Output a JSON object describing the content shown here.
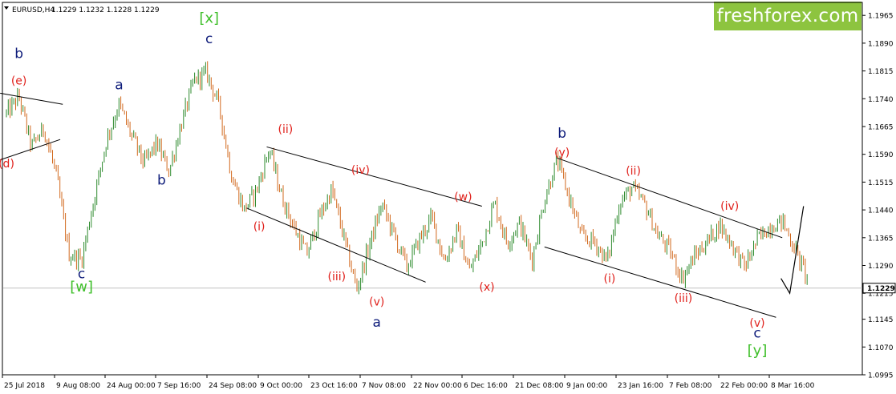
{
  "brand": {
    "logo_text": "freshforex.com"
  },
  "colors": {
    "up": "#2e8b2e",
    "down": "#d2691e",
    "red_label": "#e0201b",
    "blue_label": "#0d1b7a",
    "green_label": "#3fbf2a",
    "brand": "#8dc43f"
  },
  "chart_data": {
    "type": "candlestick",
    "symbol_label": "EURUSD,H4",
    "ohlc_label": "1.1229 1.1232 1.1228 1.1229",
    "current_price": 1.1229,
    "current_price_label": "1.1229",
    "ylim": [
      1.0995,
      1.2
    ],
    "y_ticks": [
      "1.1965",
      "1.1890",
      "1.1815",
      "1.1740",
      "1.1665",
      "1.1590",
      "1.1515",
      "1.1440",
      "1.1365",
      "1.1290",
      "1.1215",
      "1.1145",
      "1.1070",
      "1.0995"
    ],
    "x_ticks": [
      "25 Jul 2018",
      "9 Aug 08:00",
      "24 Aug 00:00",
      "7 Sep 16:00",
      "24 Sep 08:00",
      "9 Oct 00:00",
      "23 Oct 16:00",
      "7 Nov 08:00",
      "22 Nov 00:00",
      "6 Dec 16:00",
      "21 Dec 08:00",
      "9 Jan 00:00",
      "23 Jan 16:00",
      "7 Feb 08:00",
      "22 Feb 00:00",
      "8 Mar 16:00"
    ],
    "price_path": [
      [
        0,
        1.17
      ],
      [
        1,
        1.1745
      ],
      [
        2,
        1.161
      ],
      [
        3,
        1.166
      ],
      [
        4,
        1.153
      ],
      [
        5,
        1.132
      ],
      [
        6,
        1.1305
      ],
      [
        7,
        1.147
      ],
      [
        8,
        1.163
      ],
      [
        9,
        1.1725
      ],
      [
        10,
        1.164
      ],
      [
        11,
        1.1565
      ],
      [
        12,
        1.162
      ],
      [
        13,
        1.1545
      ],
      [
        14,
        1.1675
      ],
      [
        15,
        1.179
      ],
      [
        16,
        1.181
      ],
      [
        17,
        1.172
      ],
      [
        18,
        1.153
      ],
      [
        19,
        1.144
      ],
      [
        20,
        1.1495
      ],
      [
        21,
        1.1605
      ],
      [
        22,
        1.1475
      ],
      [
        23,
        1.139
      ],
      [
        24,
        1.132
      ],
      [
        25,
        1.142
      ],
      [
        26,
        1.1495
      ],
      [
        27,
        1.136
      ],
      [
        28,
        1.1225
      ],
      [
        29,
        1.1345
      ],
      [
        30,
        1.1455
      ],
      [
        31,
        1.137
      ],
      [
        32,
        1.1285
      ],
      [
        33,
        1.136
      ],
      [
        34,
        1.142
      ],
      [
        35,
        1.13
      ],
      [
        36,
        1.1385
      ],
      [
        37,
        1.1275
      ],
      [
        38,
        1.135
      ],
      [
        39,
        1.146
      ],
      [
        40,
        1.135
      ],
      [
        41,
        1.1405
      ],
      [
        42,
        1.1305
      ],
      [
        43,
        1.147
      ],
      [
        44,
        1.1575
      ],
      [
        45,
        1.147
      ],
      [
        46,
        1.1365
      ],
      [
        47,
        1.1355
      ],
      [
        48,
        1.13
      ],
      [
        49,
        1.146
      ],
      [
        50,
        1.15
      ],
      [
        51,
        1.1455
      ],
      [
        52,
        1.1375
      ],
      [
        53,
        1.133
      ],
      [
        54,
        1.1255
      ],
      [
        55,
        1.1315
      ],
      [
        56,
        1.1355
      ],
      [
        57,
        1.14
      ],
      [
        58,
        1.1345
      ],
      [
        59,
        1.1285
      ],
      [
        60,
        1.136
      ],
      [
        61,
        1.1395
      ],
      [
        62,
        1.141
      ],
      [
        63,
        1.1335
      ],
      [
        64,
        1.1255
      ]
    ],
    "trend_lines": [
      {
        "from": [
          -0.5,
          1.1755
        ],
        "to": [
          4.5,
          1.1725
        ]
      },
      {
        "from": [
          -0.5,
          1.1575
        ],
        "to": [
          4.3,
          1.163
        ]
      },
      {
        "from": [
          20.8,
          1.161
        ],
        "to": [
          38.0,
          1.145
        ]
      },
      {
        "from": [
          19.2,
          1.1445
        ],
        "to": [
          33.5,
          1.1245
        ]
      },
      {
        "from": [
          44.0,
          1.158
        ],
        "to": [
          62.0,
          1.1365
        ]
      },
      {
        "from": [
          43.0,
          1.134
        ],
        "to": [
          61.5,
          1.115
        ]
      }
    ],
    "projection": [
      [
        61.9,
        1.1255
      ],
      [
        62.6,
        1.1215
      ],
      [
        63.7,
        1.145
      ]
    ],
    "wave_labels": [
      {
        "text": "b",
        "color": "blue",
        "size": 17,
        "i": 1,
        "price": 1.185
      },
      {
        "text": "(e)",
        "color": "red",
        "size": 14,
        "i": 1,
        "price": 1.1778
      },
      {
        "text": "(d)",
        "color": "red",
        "size": 14,
        "i": 0,
        "price": 1.1555
      },
      {
        "text": "c",
        "color": "blue",
        "size": 17,
        "i": 6,
        "price": 1.1255
      },
      {
        "text": "[w]",
        "color": "green",
        "size": 18,
        "i": 6,
        "price": 1.122
      },
      {
        "text": "a",
        "color": "blue",
        "size": 17,
        "i": 9,
        "price": 1.1765
      },
      {
        "text": "b",
        "color": "blue",
        "size": 17,
        "i": 12.4,
        "price": 1.1508
      },
      {
        "text": "[x]",
        "color": "green",
        "size": 18,
        "i": 16.2,
        "price": 1.1945
      },
      {
        "text": "c",
        "color": "blue",
        "size": 17,
        "i": 16.2,
        "price": 1.189
      },
      {
        "text": "(ii)",
        "color": "red",
        "size": 14,
        "i": 22.3,
        "price": 1.1648
      },
      {
        "text": "(i)",
        "color": "red",
        "size": 14,
        "i": 20.2,
        "price": 1.1385
      },
      {
        "text": "(iv)",
        "color": "red",
        "size": 14,
        "i": 28.3,
        "price": 1.1538
      },
      {
        "text": "(iii)",
        "color": "red",
        "size": 14,
        "i": 26.4,
        "price": 1.125
      },
      {
        "text": "(v)",
        "color": "red",
        "size": 14,
        "i": 29.6,
        "price": 1.1182
      },
      {
        "text": "a",
        "color": "blue",
        "size": 17,
        "i": 29.6,
        "price": 1.1125
      },
      {
        "text": "(w)",
        "color": "red",
        "size": 14,
        "i": 36.5,
        "price": 1.1465
      },
      {
        "text": "(x)",
        "color": "red",
        "size": 14,
        "i": 38.4,
        "price": 1.1222
      },
      {
        "text": "b",
        "color": "blue",
        "size": 17,
        "i": 44.4,
        "price": 1.1635
      },
      {
        "text": "(y)",
        "color": "red",
        "size": 14,
        "i": 44.4,
        "price": 1.1585
      },
      {
        "text": "(ii)",
        "color": "red",
        "size": 14,
        "i": 50.1,
        "price": 1.1535
      },
      {
        "text": "(i)",
        "color": "red",
        "size": 14,
        "i": 48.2,
        "price": 1.1245
      },
      {
        "text": "(iv)",
        "color": "red",
        "size": 14,
        "i": 57.8,
        "price": 1.144
      },
      {
        "text": "(iii)",
        "color": "red",
        "size": 14,
        "i": 54.1,
        "price": 1.1192
      },
      {
        "text": "(v)",
        "color": "red",
        "size": 14,
        "i": 60.0,
        "price": 1.1125
      },
      {
        "text": "c",
        "color": "blue",
        "size": 17,
        "i": 60.0,
        "price": 1.1095
      },
      {
        "text": "[y]",
        "color": "green",
        "size": 18,
        "i": 60.0,
        "price": 1.1048
      }
    ]
  }
}
